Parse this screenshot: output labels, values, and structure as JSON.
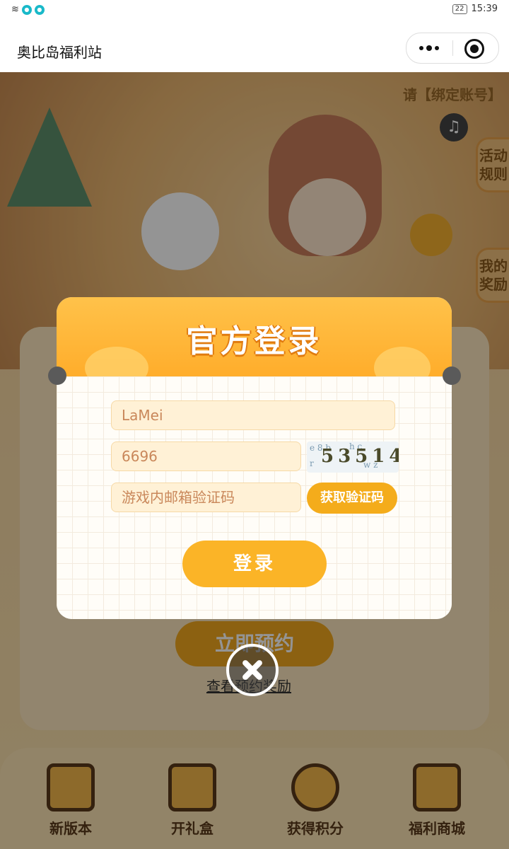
{
  "status_bar": {
    "time": "15:39",
    "battery": "22"
  },
  "app": {
    "title": "奥比岛福利站"
  },
  "background": {
    "hint_text": "请【绑定账号】",
    "side_tabs": [
      "活动规则",
      "我的奖励"
    ],
    "reserve_button": "立即预约",
    "reward_link": "查看预约奖励"
  },
  "tabbar": {
    "items": [
      {
        "label": "新版本",
        "icon": "calendar-icon"
      },
      {
        "label": "开礼盒",
        "icon": "gift-box-icon"
      },
      {
        "label": "获得积分",
        "icon": "bear-coin-icon"
      },
      {
        "label": "福利商城",
        "icon": "shop-icon"
      }
    ]
  },
  "login_modal": {
    "title": "官方登录",
    "username_value": "LaMei",
    "captcha_value": "6696",
    "email_code_placeholder": "游戏内邮箱验证码",
    "captcha_image_text": "53514",
    "get_code_button": "获取验证码",
    "login_button": "登录"
  },
  "colors": {
    "accent": "#f4ac1b",
    "modal_header": "#ffb53a"
  }
}
